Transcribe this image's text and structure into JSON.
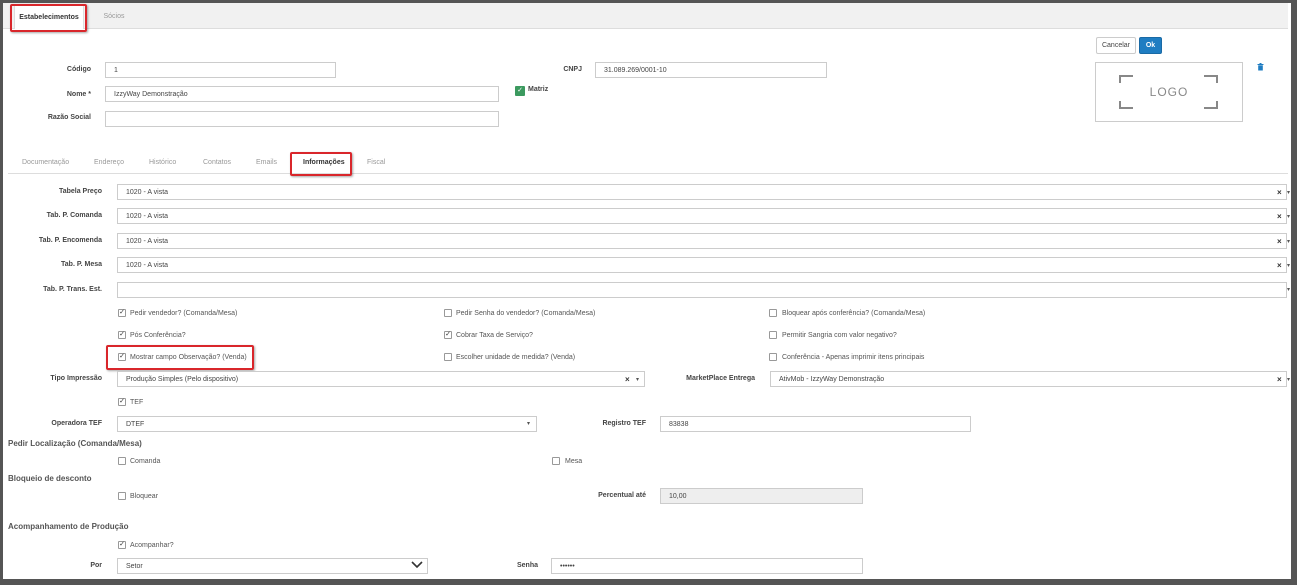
{
  "top_tabs": {
    "establishments": "Estabelecimentos",
    "partners": "Sócios"
  },
  "actions": {
    "cancel": "Cancelar",
    "ok": "Ok"
  },
  "logo_text": "LOGO",
  "fields": {
    "codigo_label": "Código",
    "codigo_value": "1",
    "cnpj_label": "CNPJ",
    "cnpj_value": "31.089.269/0001-10",
    "nome_label": "Nome *",
    "nome_value": "IzzyWay Demonstração",
    "matriz_label": "Matriz",
    "razao_label": "Razão Social",
    "razao_value": ""
  },
  "sub_tabs": [
    "Documentação",
    "Endereço",
    "Histórico",
    "Contatos",
    "Emails",
    "Informações",
    "Fiscal"
  ],
  "tables": {
    "tabela_preco_label": "Tabela Preço",
    "tabela_preco_value": "1020 - A vista",
    "comanda_label": "Tab. P. Comanda",
    "comanda_value": "1020 - A vista",
    "encomenda_label": "Tab. P. Encomenda",
    "encomenda_value": "1020 - A vista",
    "mesa_label": "Tab. P. Mesa",
    "mesa_value": "1020 - A vista",
    "trans_label": "Tab. P. Trans. Est.",
    "trans_value": ""
  },
  "options": [
    {
      "label": "Pedir vendedor? (Comanda/Mesa)",
      "checked": true
    },
    {
      "label": "Pedir Senha do vendedor? (Comanda/Mesa)",
      "checked": false
    },
    {
      "label": "Bloquear após conferência? (Comanda/Mesa)",
      "checked": false
    },
    {
      "label": "Pós Conferência?",
      "checked": true
    },
    {
      "label": "Cobrar Taxa de Serviço?",
      "checked": true
    },
    {
      "label": "Permitir Sangria com valor negativo?",
      "checked": false
    },
    {
      "label": "Mostrar campo Observação? (Venda)",
      "checked": true
    },
    {
      "label": "Escolher unidade de medida? (Venda)",
      "checked": false
    },
    {
      "label": "Conferência - Apenas imprimir itens principais",
      "checked": false
    }
  ],
  "print": {
    "tipo_label": "Tipo Impressão",
    "tipo_value": "Produção Simples (Pelo dispositivo)",
    "marketplace_label": "MarketPlace Entrega",
    "marketplace_value": "AtivMob - IzzyWay Demonstração"
  },
  "tef": {
    "tef_label": "TEF",
    "operadora_label": "Operadora TEF",
    "operadora_value": "DTEF",
    "registro_label": "Registro TEF",
    "registro_value": "83838"
  },
  "localizacao": {
    "title": "Pedir Localização (Comanda/Mesa)",
    "comanda": "Comanda",
    "mesa": "Mesa"
  },
  "desconto": {
    "title": "Bloqueio de desconto",
    "bloquear": "Bloquear",
    "percentual_label": "Percentual até",
    "percentual_value": "10,00"
  },
  "producao": {
    "title": "Acompanhamento de Produção",
    "acompanhar": "Acompanhar?",
    "por_label": "Por",
    "por_value": "Setor",
    "senha_label": "Senha",
    "senha_value": "••••••"
  },
  "colors": {
    "accent": "#1f7dc2",
    "highlight": "#d9262b",
    "check": "#3c9a5f"
  }
}
